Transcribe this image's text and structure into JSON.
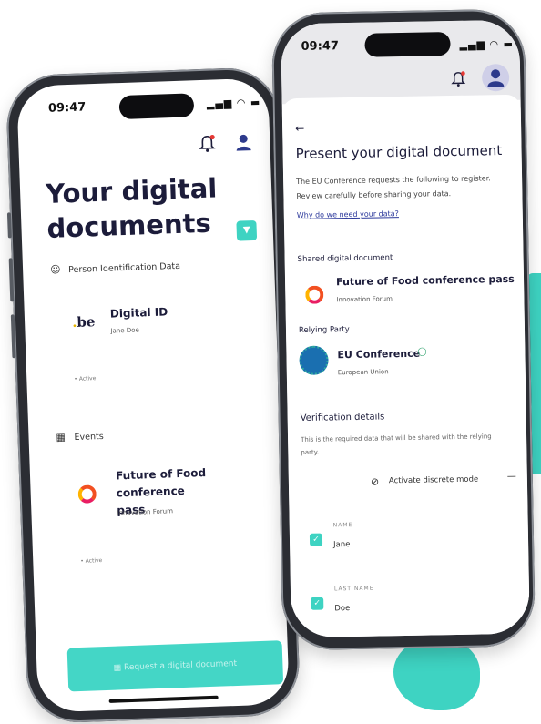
{
  "left_phone": {
    "status_time": "09:47",
    "status_icons": "▂▄▆ ◠ ▬",
    "title": "Your digital\ndocuments",
    "add_icon": "chevron-down-icon",
    "sections": [
      {
        "label": "Person Identification Data",
        "icon": "person-icon",
        "card": {
          "title": "Digital ID",
          "subtitle": "Jane Doe",
          "status": "• Active",
          "logo": ".be"
        }
      },
      {
        "label": "Events",
        "icon": "ticket-icon",
        "card": {
          "title": "Future of Food conference\npass",
          "subtitle": "Innovation Forum",
          "status": "• Active"
        }
      }
    ],
    "bottom_button": "Request a digital document"
  },
  "right_phone": {
    "status_time": "09:47",
    "status_icons": "▂▄▆ ◠ ▬",
    "back_icon": "back-arrow-icon",
    "title": "Present your digital document",
    "intro": "The EU Conference requests the following to register.\nReview carefully before sharing your data.",
    "why_link": "Why do we need your data?",
    "shared_label": "Shared digital document",
    "shared_card": {
      "title": "Future of Food conference pass",
      "subtitle": "Innovation Forum"
    },
    "relying_label": "Relying Party",
    "relying_card": {
      "title": "EU Conference",
      "subtitle": "European Union"
    },
    "verification_label": "Verification details",
    "verification_text": "This is the required data that will be shared with the relying\nparty.",
    "discrete_mode": "Activate discrete mode",
    "fields": [
      {
        "label": "NAME",
        "value": "Jane"
      },
      {
        "label": "LAST NAME",
        "value": "Doe"
      }
    ]
  },
  "colors": {
    "accent": "#3ed3c2",
    "text": "#1c1c3a",
    "link": "#2d3a9c"
  }
}
